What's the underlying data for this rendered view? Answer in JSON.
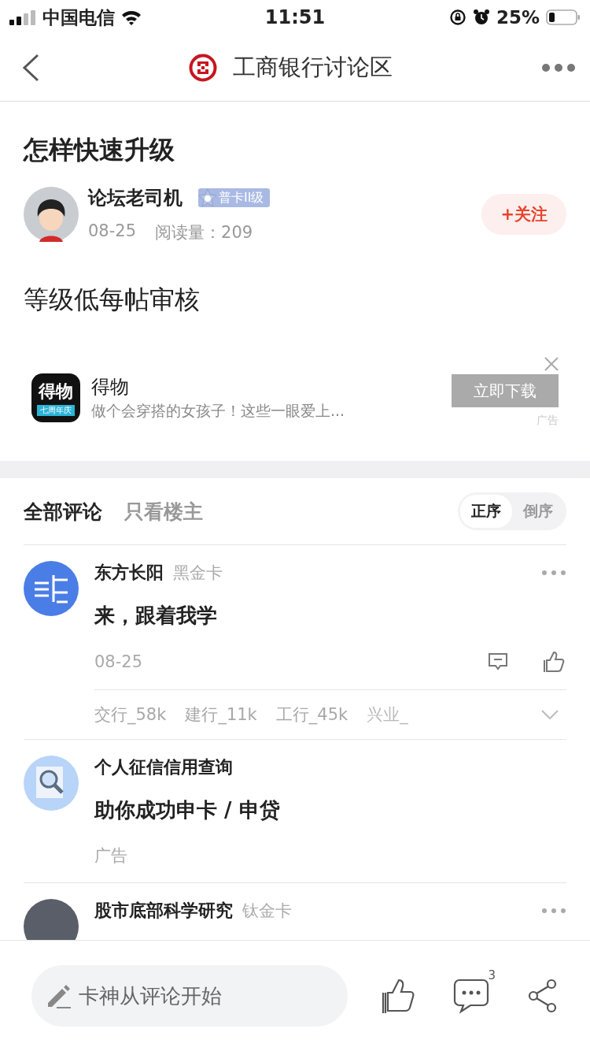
{
  "status_bar": {
    "carrier": "中国电信",
    "time": "11:51",
    "battery": "25%"
  },
  "nav": {
    "title": "工商银行讨论区"
  },
  "post": {
    "title": "怎样快速升级",
    "author": "论坛老司机",
    "badge": "普卡II级",
    "date": "08-25",
    "reads": "阅读量：209",
    "follow": "+关注",
    "body": "等级低每帖审核"
  },
  "ad": {
    "name": "得物",
    "logo_text": "得物",
    "app_label": "七周年庆",
    "desc": "做个会穿搭的女孩子！这些一眼爱上...",
    "button": "立即下载",
    "tag": "广告"
  },
  "comment_tabs": [
    {
      "label": "全部评论",
      "selected": true
    },
    {
      "label": "只看楼主",
      "selected": false
    }
  ],
  "sort": [
    {
      "label": "正序",
      "selected": true
    },
    {
      "label": "倒序",
      "selected": false
    }
  ],
  "comments": [
    {
      "kind": "comment",
      "name": "东方长阳",
      "level": "黑金卡",
      "text": "来，跟着我学",
      "date": "08-25",
      "tags": [
        "交行_58k",
        "建行_11k",
        "工行_45k",
        "兴业_"
      ]
    },
    {
      "kind": "ad",
      "name": "个人征信信用查询",
      "text": "助你成功申卡 / 申贷",
      "date": "广告"
    },
    {
      "kind": "comment",
      "name": "股市底部科学研究",
      "level": "钛金卡"
    }
  ],
  "bottom": {
    "placeholder": "卡神从评论开始",
    "comment_count": "3"
  }
}
